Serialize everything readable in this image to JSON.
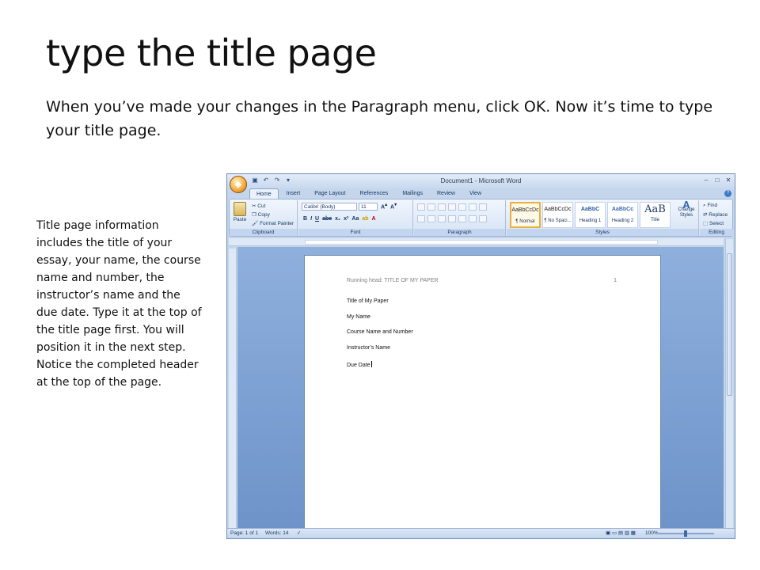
{
  "slide": {
    "title": "type the title page",
    "subtitle": "When you’ve made your changes in the Paragraph menu, click OK. Now it’s time to type your title page.",
    "note": "Title page information includes the title of your essay, your name, the course name and number, the instructor’s name and the due date. Type it at the top of the title page first. You will position it in the next step. Notice the completed header at the top of the page."
  },
  "word": {
    "window_title": "Document1 - Microsoft Word",
    "tabs": [
      "Home",
      "Insert",
      "Page Layout",
      "References",
      "Mailings",
      "Review",
      "View"
    ],
    "clipboard": {
      "paste": "Paste",
      "cut": "Cut",
      "copy": "Copy",
      "format_painter": "Format Painter",
      "label": "Clipboard"
    },
    "font": {
      "name": "Calibri (Body)",
      "size": "11",
      "label": "Font"
    },
    "paragraph": {
      "label": "Paragraph"
    },
    "styles": {
      "label": "Styles",
      "change_styles": "Change Styles",
      "cards": [
        {
          "sample": "AaBbCcDc",
          "name": "¶ Normal"
        },
        {
          "sample": "AaBbCcDc",
          "name": "¶ No Spaci..."
        },
        {
          "sample": "AaBbC",
          "name": "Heading 1"
        },
        {
          "sample": "AaBbCc",
          "name": "Heading 2"
        },
        {
          "sample": "AaB",
          "name": "Title"
        }
      ]
    },
    "editing": {
      "find": "Find",
      "replace": "Replace",
      "select": "Select",
      "label": "Editing"
    },
    "document": {
      "running_head": "Running head: TITLE OF MY PAPER",
      "page_number": "1",
      "lines": [
        "Title of My Paper",
        "My Name",
        "Course Name and Number",
        "Instructor’s Name",
        "Due Date"
      ]
    },
    "status": {
      "page": "Page: 1 of 1",
      "words": "Words: 14",
      "zoom": "100%"
    },
    "colors": {
      "ribbon": "#d5e3f5",
      "doc_bg": "#6d93c9",
      "active_style": "#e8b03e"
    }
  }
}
